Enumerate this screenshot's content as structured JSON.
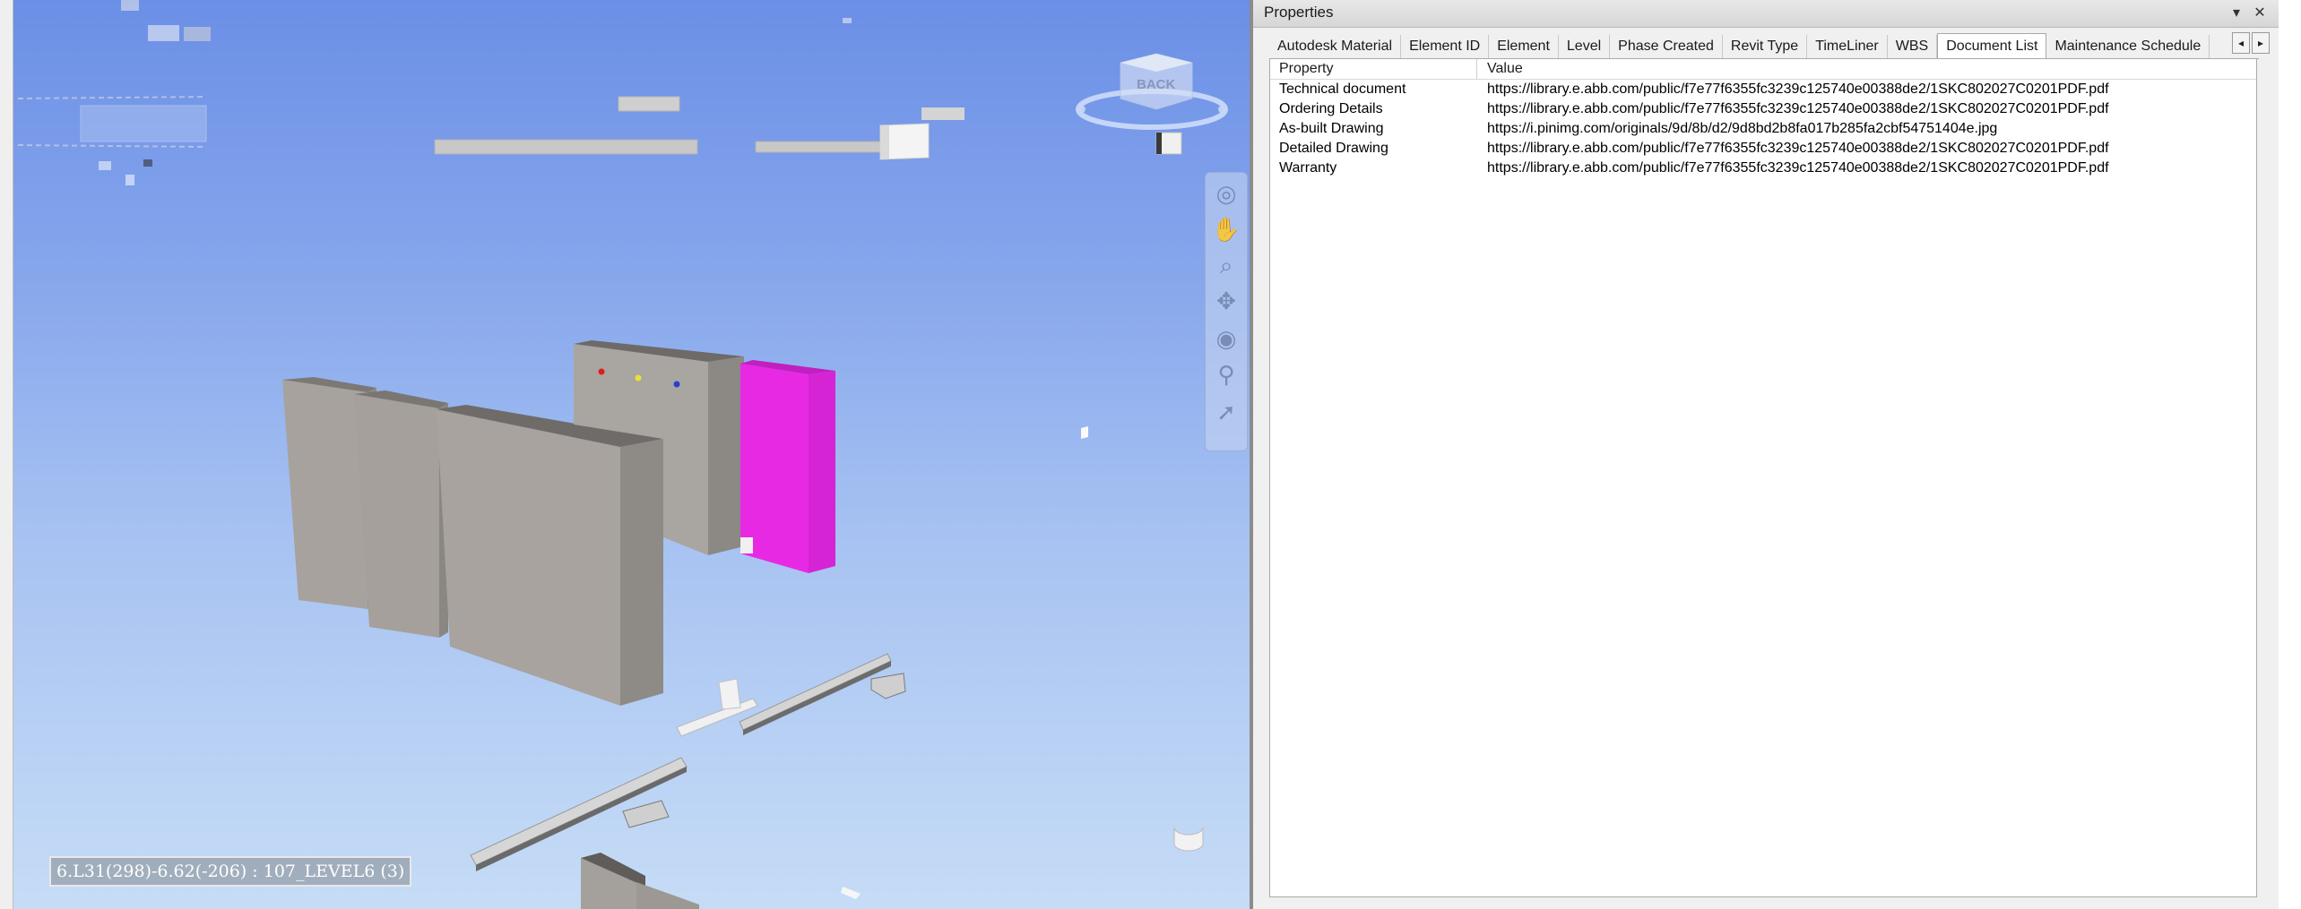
{
  "viewport": {
    "status_label": "6.L31(298)-6.62(-206) : 107_LEVEL6 (3)",
    "viewcube_label": "BACK",
    "nav_tools": [
      {
        "icon": "steering-wheel-icon",
        "glyph": "◎"
      },
      {
        "icon": "pan-hand-icon",
        "glyph": "✋"
      },
      {
        "icon": "zoom-icon",
        "glyph": "⌕"
      },
      {
        "icon": "orbit-icon",
        "glyph": "✥"
      },
      {
        "icon": "look-icon",
        "glyph": "◉"
      },
      {
        "icon": "walk-icon",
        "glyph": "⚲"
      },
      {
        "icon": "select-icon",
        "glyph": "➚"
      }
    ],
    "highlight_color": "#e829e4"
  },
  "panel": {
    "title": "Properties",
    "title_buttons": {
      "pin": "▾",
      "close": "✕"
    },
    "tabs": [
      "Autodesk Material",
      "Element ID",
      "Element",
      "Level",
      "Phase Created",
      "Revit Type",
      "TimeLiner",
      "WBS",
      "Document List",
      "Maintenance Schedule"
    ],
    "active_tab": "Document List",
    "tab_scroll": {
      "left": "◂",
      "right": "▸"
    },
    "columns": {
      "property": "Property",
      "value": "Value"
    },
    "rows": [
      {
        "property": "Technical document",
        "value": "https://library.e.abb.com/public/f7e77f6355fc3239c125740e00388de2/1SKC802027C0201PDF.pdf"
      },
      {
        "property": "Ordering Details",
        "value": "https://library.e.abb.com/public/f7e77f6355fc3239c125740e00388de2/1SKC802027C0201PDF.pdf"
      },
      {
        "property": "As-built Drawing",
        "value": "https://i.pinimg.com/originals/9d/8b/d2/9d8bd2b8fa017b285fa2cbf54751404e.jpg"
      },
      {
        "property": "Detailed Drawing",
        "value": "https://library.e.abb.com/public/f7e77f6355fc3239c125740e00388de2/1SKC802027C0201PDF.pdf"
      },
      {
        "property": "Warranty",
        "value": "https://library.e.abb.com/public/f7e77f6355fc3239c125740e00388de2/1SKC802027C0201PDF.pdf"
      }
    ]
  }
}
